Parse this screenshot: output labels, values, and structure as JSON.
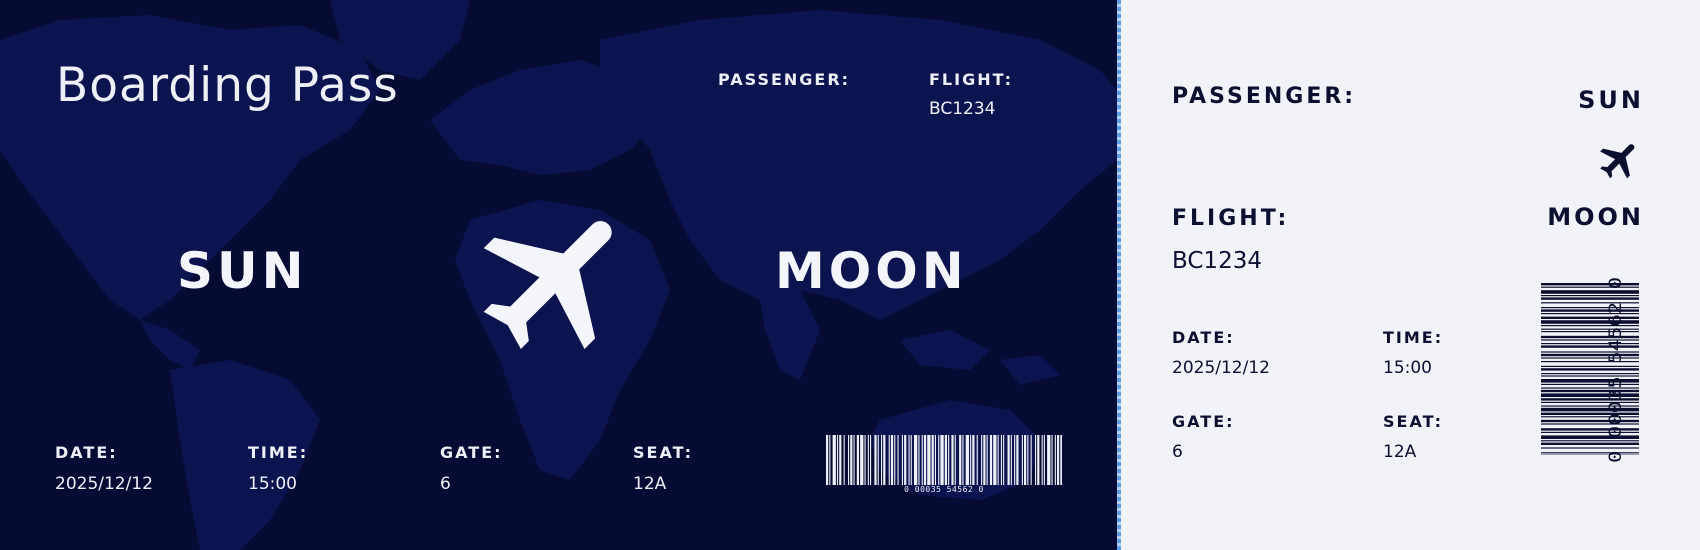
{
  "colors": {
    "main_bg": "#060b34",
    "map_land": "#0c1450",
    "text_light": "#eef0f8",
    "stub_bg": "#f2f3f8",
    "stub_text": "#0c1030",
    "divider": "#5d9ee8"
  },
  "main": {
    "title": "Boarding Pass",
    "passenger_label": "PASSENGER:",
    "flight_label": "FLIGHT:",
    "flight_value": "BC1234",
    "origin": "SUN",
    "destination": "MOON",
    "date_label": "DATE:",
    "date_value": "2025/12/12",
    "time_label": "TIME:",
    "time_value": "15:00",
    "gate_label": "GATE:",
    "gate_value": "6",
    "seat_label": "SEAT:",
    "seat_value": "12A",
    "barcode_text": "0 00035 54562 0",
    "plane_icon": "airplane-icon"
  },
  "stub": {
    "passenger_label": "PASSENGER:",
    "origin": "SUN",
    "destination": "MOON",
    "flight_label": "FLIGHT:",
    "flight_value": "BC1234",
    "date_label": "DATE:",
    "date_value": "2025/12/12",
    "time_label": "TIME:",
    "time_value": "15:00",
    "gate_label": "GATE:",
    "gate_value": "6",
    "seat_label": "SEAT:",
    "seat_value": "12A",
    "barcode_text": "0 00035 54562 0",
    "plane_icon": "airplane-icon"
  }
}
